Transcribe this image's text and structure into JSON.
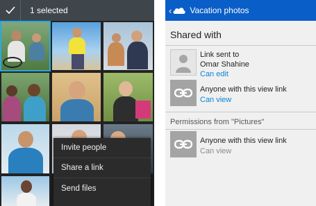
{
  "left_screen": {
    "actionbar": {
      "check_icon": "checkmark-icon",
      "selected_label": "1 selected"
    },
    "context_menu": {
      "items": [
        "Invite people",
        "Share a link",
        "Send files"
      ]
    }
  },
  "right_screen": {
    "topbar": {
      "back_icon": "chevron-left-icon",
      "cloud_icon": "onedrive-cloud-icon",
      "title": "Vacation photos"
    },
    "shared_with": {
      "header": "Shared with",
      "entries": [
        {
          "icon": "person-avatar-icon",
          "line1": "Link sent to",
          "line2": "Omar Shahine",
          "permission": "Can edit"
        },
        {
          "icon": "link-icon",
          "line1": "Anyone with this view link",
          "permission": "Can view"
        }
      ]
    },
    "inherited": {
      "header": "Permissions from \"Pictures\"",
      "entries": [
        {
          "icon": "link-icon",
          "line1": "Anyone with this view link",
          "permission": "Can view"
        }
      ]
    }
  },
  "colors": {
    "left_actionbar": "#3f464b",
    "selection_accent": "#2aa9e0",
    "right_topbar": "#0a5ec7",
    "link_blue": "#0a84d6"
  }
}
